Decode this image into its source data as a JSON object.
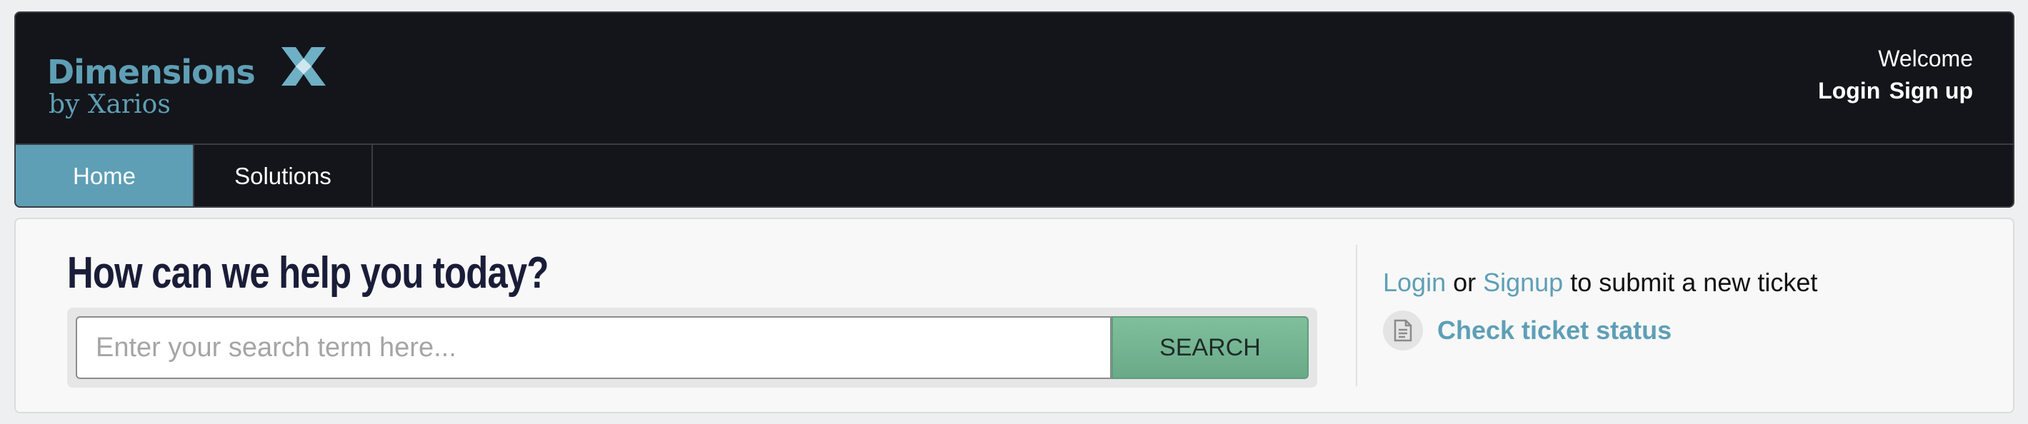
{
  "header": {
    "logo": {
      "line1": "Dimensions",
      "line2": "by Xarios",
      "mark": "X"
    },
    "welcome": "Welcome",
    "login_label": "Login",
    "signup_label": "Sign up"
  },
  "nav": {
    "tabs": [
      {
        "label": "Home",
        "active": true
      },
      {
        "label": "Solutions",
        "active": false
      }
    ]
  },
  "main": {
    "title": "How can we help you today?",
    "search": {
      "placeholder": "Enter your search term here...",
      "value": "",
      "button_label": "SEARCH"
    },
    "side": {
      "login_link": "Login",
      "or_text": " or ",
      "signup_link": "Signup",
      "submit_text": " to submit a new ticket",
      "status_link": "Check ticket status",
      "status_icon": "document-icon"
    }
  },
  "colors": {
    "header_bg": "#13151a",
    "accent": "#5e9fb6",
    "search_button": "#7fbf9c",
    "title": "#1a1d38"
  }
}
